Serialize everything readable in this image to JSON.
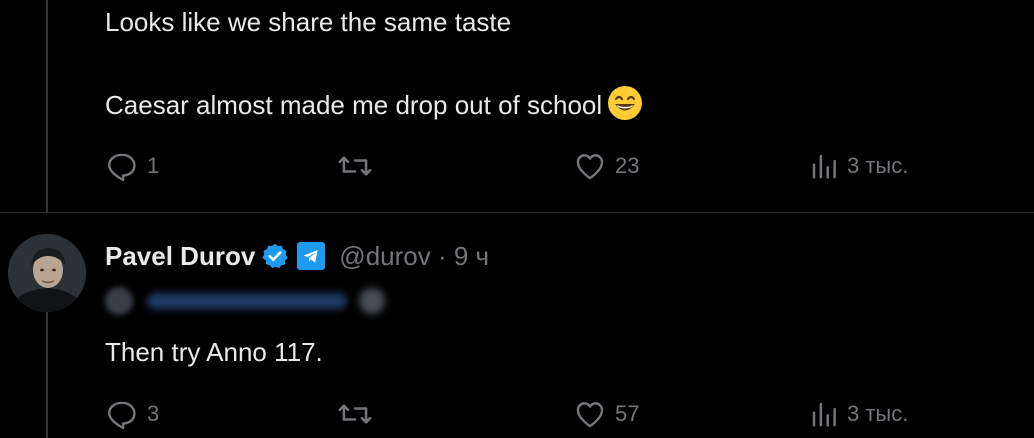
{
  "tweet1": {
    "line1": "Looks like we share the same taste",
    "line2": "Caesar almost made me drop out of school",
    "emoji": "grinning-squinting-face",
    "actions": {
      "replies": "1",
      "likes": "23",
      "views": "3 тыс."
    }
  },
  "tweet2": {
    "author_name": "Pavel Durov",
    "handle": "@durov · 9 ч",
    "text": "Then try Anno 117.",
    "actions": {
      "replies": "3",
      "likes": "57",
      "views": "3 тыс."
    }
  },
  "colors": {
    "background": "#000000",
    "text": "#e7e9ea",
    "muted": "#71767b",
    "accent": "#1d9bf0",
    "thread_line": "#333639"
  },
  "icons": [
    "reply-icon",
    "retweet-icon",
    "like-icon",
    "views-icon",
    "verified-icon",
    "telegram-icon"
  ]
}
